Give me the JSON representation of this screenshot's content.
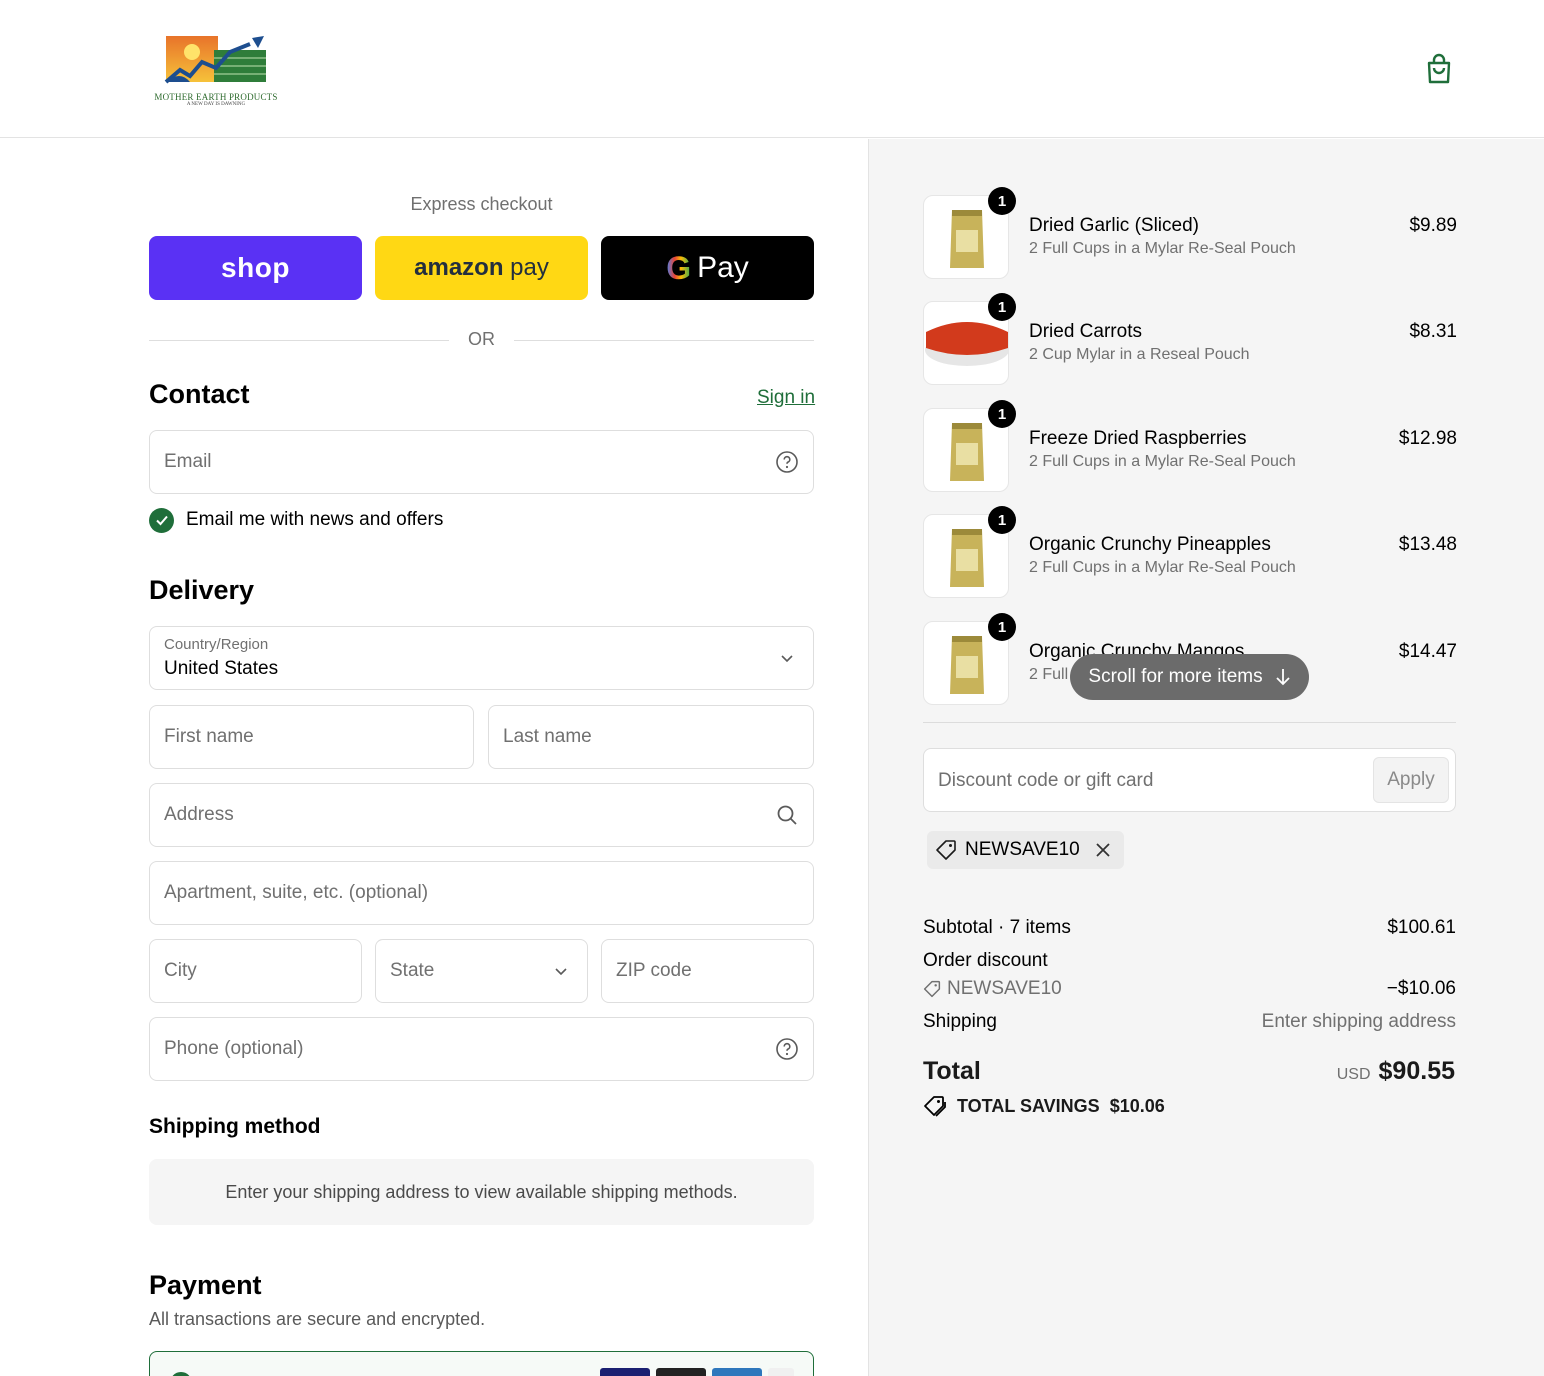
{
  "brand": {
    "name": "MOTHER EARTH PRODUCTS",
    "tagline": "A NEW DAY IS DAWNING"
  },
  "header": {
    "cart_icon": "shopping-bag-icon"
  },
  "express": {
    "title": "Express checkout",
    "shop_label": "shop",
    "amazon_label_bold": "amazon",
    "amazon_label": "pay",
    "gpay_g": "G",
    "gpay_label": "Pay",
    "or_label": "OR"
  },
  "contact": {
    "title": "Contact",
    "sign_in": "Sign in",
    "email_placeholder": "Email",
    "newsletter_label": "Email me with news and offers"
  },
  "delivery": {
    "title": "Delivery",
    "country_label": "Country/Region",
    "country_value": "United States",
    "first_name": "First name",
    "last_name": "Last name",
    "address": "Address",
    "apartment": "Apartment, suite, etc. (optional)",
    "city": "City",
    "state": "State",
    "zip": "ZIP code",
    "phone": "Phone (optional)"
  },
  "shipping": {
    "title": "Shipping method",
    "notice": "Enter your shipping address to view available shipping methods."
  },
  "payment": {
    "title": "Payment",
    "subtitle": "All transactions are secure and encrypted."
  },
  "cart": {
    "items": [
      {
        "name": "Dried Garlic (Sliced)",
        "desc": "2 Full Cups in a Mylar Re-Seal Pouch",
        "price": "$9.89",
        "qty": "1"
      },
      {
        "name": "Dried Carrots",
        "desc": "2 Cup Mylar in a Reseal Pouch",
        "price": "$8.31",
        "qty": "1"
      },
      {
        "name": "Freeze Dried Raspberries",
        "desc": "2 Full Cups in a Mylar Re-Seal Pouch",
        "price": "$12.98",
        "qty": "1"
      },
      {
        "name": "Organic Crunchy Pineapples",
        "desc": "2 Full Cups in a Mylar Re-Seal Pouch",
        "price": "$13.48",
        "qty": "1"
      },
      {
        "name": "Organic Crunchy Mangos",
        "desc": "2 Full",
        "price": "$14.47",
        "qty": "1"
      }
    ],
    "scroll_label": "Scroll for more items",
    "discount_placeholder": "Discount code or gift card",
    "apply_label": "Apply",
    "applied_code": "NEWSAVE10"
  },
  "summary": {
    "subtotal_label": "Subtotal · 7 items",
    "subtotal_value": "$100.61",
    "discount_label": "Order discount",
    "discount_code": "NEWSAVE10",
    "discount_value": "−$10.06",
    "shipping_label": "Shipping",
    "shipping_value": "Enter shipping address",
    "total_label": "Total",
    "currency": "USD",
    "total_value": "$90.55",
    "savings_label": "TOTAL SAVINGS",
    "savings_value": "$10.06"
  },
  "colors": {
    "accent": "#1f6e3a",
    "shop": "#5a31f4",
    "amazon": "#ffd814",
    "gpay": "#000000"
  }
}
